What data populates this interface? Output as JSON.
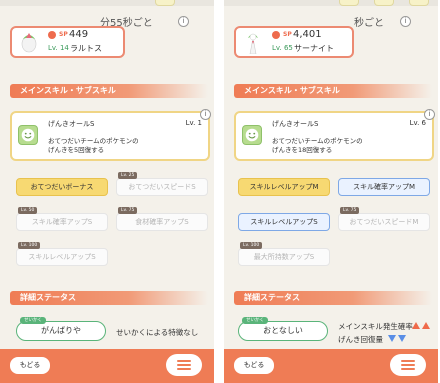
{
  "left": {
    "timer": "分55秒ごと",
    "pokemon": {
      "sp_label": "SP",
      "sp": "449",
      "level": "Lv. 14",
      "name": "ラルトス"
    },
    "section_skill": "メインスキル・サブスキル",
    "main_skill": {
      "name": "げんきオールS",
      "level": "Lv. 1",
      "desc_line1": "おてつだいチームのポケモンの",
      "desc_line2": "げんきを5回復する"
    },
    "subskills": [
      {
        "label": "おてつだいボーナス",
        "lock": ""
      },
      {
        "label": "おてつだいスピードS",
        "lock": "Lv. 25"
      },
      {
        "label": "スキル確率アップS",
        "lock": "Lv. 50"
      },
      {
        "label": "食材確率アップS",
        "lock": "Lv. 75"
      },
      {
        "label": "スキルレベルアップS",
        "lock": "Lv. 100"
      }
    ],
    "section_detail": "詳細ステータス",
    "nature_tag": "せいかく",
    "nature": "がんばりや",
    "nature_effect": "せいかくによる特徴なし",
    "back": "もどる"
  },
  "right": {
    "timer": "秒ごと",
    "pokemon": {
      "sp_label": "SP",
      "sp": "4,401",
      "level": "Lv. 65",
      "name": "サーナイト"
    },
    "section_skill": "メインスキル・サブスキル",
    "main_skill": {
      "name": "げんきオールS",
      "level": "Lv. 6",
      "desc_line1": "おてつだいチームのポケモンの",
      "desc_line2": "げんきを18回復する"
    },
    "subskills": [
      {
        "label": "スキルレベルアップM",
        "lock": ""
      },
      {
        "label": "スキル確率アップM",
        "lock": ""
      },
      {
        "label": "スキルレベルアップS",
        "lock": ""
      },
      {
        "label": "おてつだいスピードM",
        "lock": "Lv. 75"
      },
      {
        "label": "最大所持数アップS",
        "lock": "Lv. 100"
      }
    ],
    "section_detail": "詳細ステータス",
    "nature_tag": "せいかく",
    "nature": "おとなしい",
    "nature_up": "メインスキル発生確率",
    "nature_down": "げんき回復量",
    "back": "もどる"
  },
  "info_symbol": "i",
  "colors": {
    "accent": "#ef7c55",
    "main_skill_border": "#f0d585",
    "subskill_gold": "#f7d972",
    "subskill_blue": "#7ea8e6",
    "nature_green": "#5ab47a",
    "up_arrow": "#ef6a4a",
    "down_arrow": "#5a8ee6"
  }
}
